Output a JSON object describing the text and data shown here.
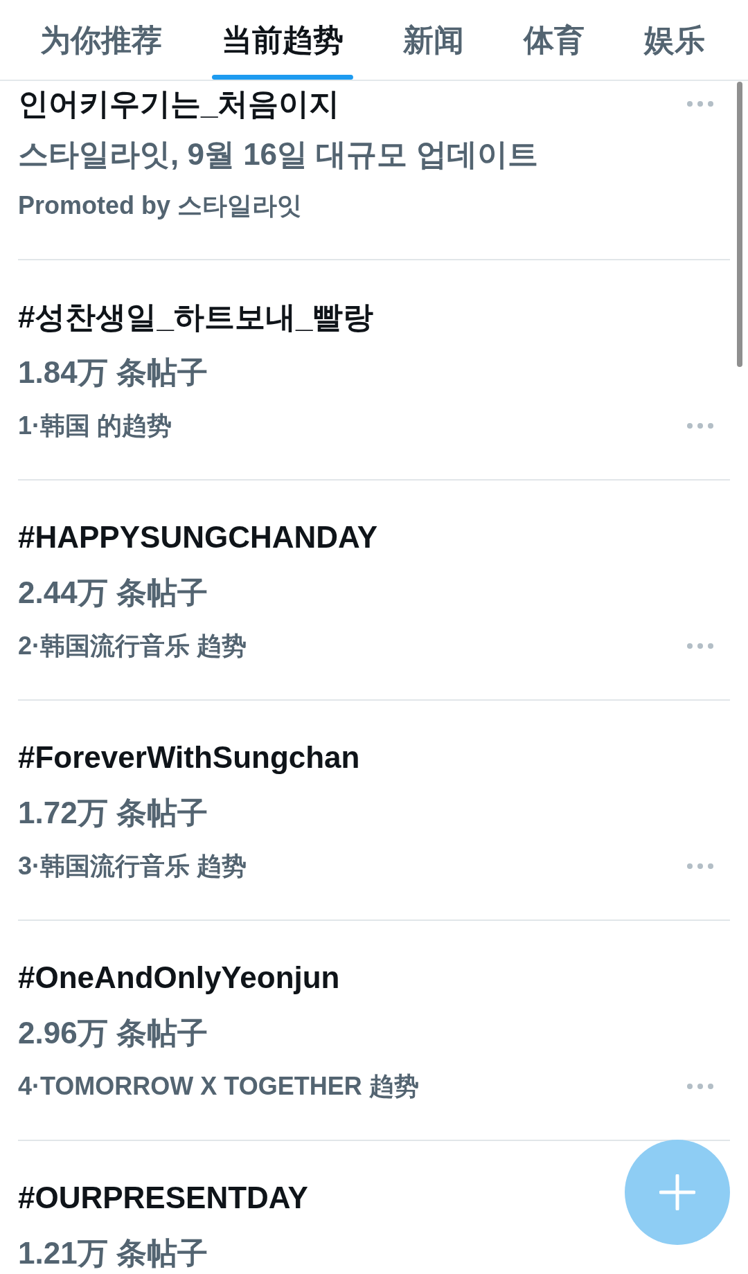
{
  "tabs": [
    {
      "label": "为你推荐",
      "selected": false
    },
    {
      "label": "当前趋势",
      "selected": true
    },
    {
      "label": "新闻",
      "selected": false
    },
    {
      "label": "体育",
      "selected": false
    },
    {
      "label": "娱乐",
      "selected": false
    }
  ],
  "trends": [
    {
      "kind": "promoted",
      "title": "인어키우기는_처음이지",
      "description": "스타일라잇, 9월 16일 대규모 업데이트",
      "promoted_by": "Promoted by 스타일라잇"
    },
    {
      "kind": "trend",
      "title": "#성찬생일_하트보내_빨랑",
      "post_count": "1.84万 条帖子",
      "context": "1·韩国 的趋势"
    },
    {
      "kind": "trend",
      "title": "#HAPPYSUNGCHANDAY",
      "post_count": "2.44万 条帖子",
      "context": "2·韩国流行音乐 趋势"
    },
    {
      "kind": "trend",
      "title": "#ForeverWithSungchan",
      "post_count": "1.72万 条帖子",
      "context": "3·韩国流行音乐 趋势"
    },
    {
      "kind": "trend",
      "title": "#OneAndOnlyYeonjun",
      "post_count": "2.96万 条帖子",
      "context": "4·TOMORROW X TOGETHER 趋势"
    },
    {
      "kind": "trend",
      "title": "#OURPRESENTDAY",
      "post_count": "1.21万 条帖子"
    }
  ]
}
